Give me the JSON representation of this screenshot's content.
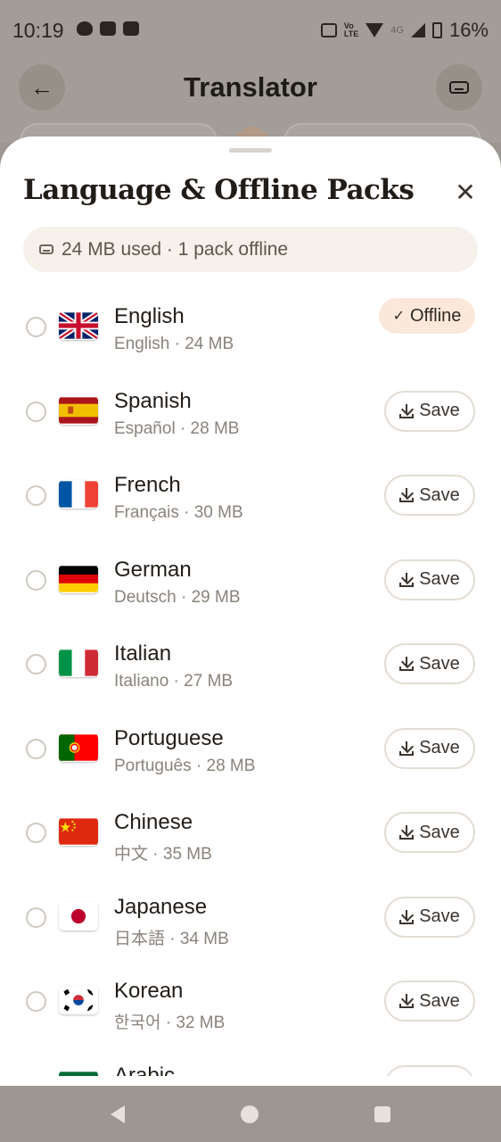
{
  "status_bar": {
    "time": "10:19",
    "network": "4G",
    "battery": "16%"
  },
  "header": {
    "title": "Translator"
  },
  "sheet": {
    "title": "Language & Offline Packs",
    "usage": "24 MB used · 1 pack offline"
  },
  "languages": [
    {
      "name": "English",
      "subtitle": "English · 24 MB",
      "flag": "gb",
      "action": "Offline"
    },
    {
      "name": "Spanish",
      "subtitle": "Español · 28 MB",
      "flag": "es",
      "action": "Save"
    },
    {
      "name": "French",
      "subtitle": "Français · 30 MB",
      "flag": "fr",
      "action": "Save"
    },
    {
      "name": "German",
      "subtitle": "Deutsch · 29 MB",
      "flag": "de",
      "action": "Save"
    },
    {
      "name": "Italian",
      "subtitle": "Italiano · 27 MB",
      "flag": "it",
      "action": "Save"
    },
    {
      "name": "Portuguese",
      "subtitle": "Português · 28 MB",
      "flag": "pt",
      "action": "Save"
    },
    {
      "name": "Chinese",
      "subtitle": "中文 · 35 MB",
      "flag": "cn",
      "action": "Save"
    },
    {
      "name": "Japanese",
      "subtitle": "日本語 · 34 MB",
      "flag": "jp",
      "action": "Save"
    },
    {
      "name": "Korean",
      "subtitle": "한국어 · 32 MB",
      "flag": "kr",
      "action": "Save"
    },
    {
      "name": "Arabic",
      "subtitle": "",
      "flag": "sa",
      "action": "Save"
    }
  ],
  "colors": {
    "accent_offline_bg": "#fbe8db",
    "sheet_bg": "#ffffff",
    "scrim": "#9c9790"
  }
}
